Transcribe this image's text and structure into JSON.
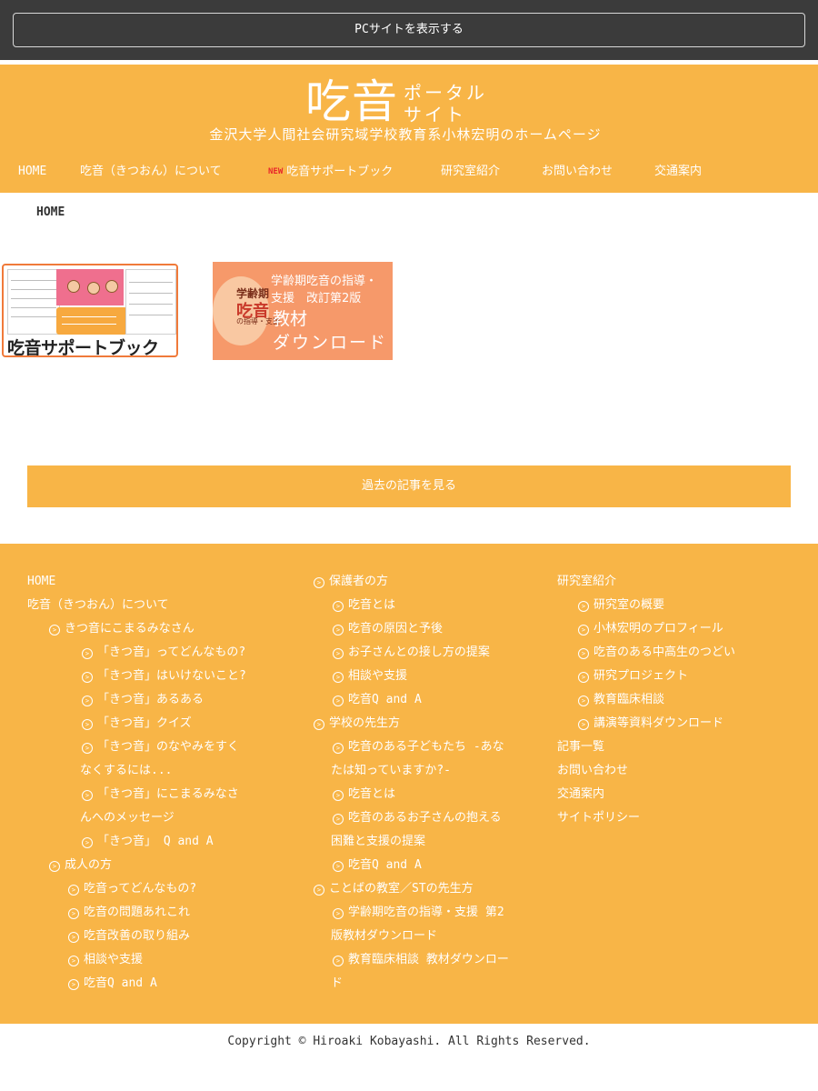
{
  "topbar": {
    "pc_site_button": "PCサイトを表示する"
  },
  "header": {
    "logo_main": "吃音",
    "logo_sub_line1": "ポータル",
    "logo_sub_line2": "サイト",
    "tagline": "金沢大学人間社会研究域学校教育系小林宏明のホームページ"
  },
  "gnav": {
    "items": [
      {
        "label": "HOME"
      },
      {
        "label": "吃音（きつおん）について"
      },
      {
        "label": "吃音サポートブック",
        "badge": "NEW"
      },
      {
        "label": "研究室紹介"
      },
      {
        "label": "お問い合わせ"
      },
      {
        "label": "交通案内"
      }
    ]
  },
  "breadcrumb": "HOME",
  "banners": {
    "support_book": {
      "title": "吃音サポートブック"
    },
    "download": {
      "book_title_small": "学齢期",
      "book_title_big": "吃音",
      "book_subtitle": "の指導・支援",
      "line1": "学齢期吃音の指導・",
      "line2": "支援　改訂第2版",
      "line3": "教材",
      "line4": "ダウンロード"
    }
  },
  "more_button": "過去の記事を見る",
  "footer": {
    "col1": [
      {
        "label": "HOME"
      },
      {
        "label": "吃音（きつおん）について"
      },
      {
        "label": "きつ音にこまるみなさん"
      },
      {
        "label": "「きつ音」ってどんなもの?"
      },
      {
        "label": "「きつ音」はいけないこと?"
      },
      {
        "label": "「きつ音」あるある"
      },
      {
        "label": "「きつ音」クイズ"
      },
      {
        "label": "「きつ音」のなやみをすく"
      },
      {
        "label": "なくするには..."
      },
      {
        "label": "「きつ音」にこまるみなさ"
      },
      {
        "label": "んへのメッセージ"
      },
      {
        "label": "「きつ音」 Q and A"
      },
      {
        "label": "成人の方"
      },
      {
        "label": "吃音ってどんなもの?"
      },
      {
        "label": "吃音の問題あれこれ"
      },
      {
        "label": "吃音改善の取り組み"
      },
      {
        "label": "相談や支援"
      },
      {
        "label": "吃音Q and A"
      }
    ],
    "col2": [
      {
        "label": "保護者の方"
      },
      {
        "label": "吃音とは"
      },
      {
        "label": "吃音の原因と予後"
      },
      {
        "label": "お子さんとの接し方の提案"
      },
      {
        "label": "相談や支援"
      },
      {
        "label": "吃音Q and A"
      },
      {
        "label": "学校の先生方"
      },
      {
        "label": "吃音のある子どもたち -あな"
      },
      {
        "label": "たは知っていますか?-"
      },
      {
        "label": "吃音とは"
      },
      {
        "label": "吃音のあるお子さんの抱える"
      },
      {
        "label": "困難と支援の提案"
      },
      {
        "label": "吃音Q and A"
      },
      {
        "label": "ことばの教室／STの先生方"
      },
      {
        "label": "学齢期吃音の指導・支援 第2"
      },
      {
        "label": "版教材ダウンロード"
      },
      {
        "label": "教育臨床相談 教材ダウンロー"
      },
      {
        "label": "ド"
      }
    ],
    "col3": [
      {
        "label": "研究室紹介"
      },
      {
        "label": "研究室の概要"
      },
      {
        "label": "小林宏明のプロフィール"
      },
      {
        "label": "吃音のある中高生のつどい"
      },
      {
        "label": "研究プロジェクト"
      },
      {
        "label": "教育臨床相談"
      },
      {
        "label": "講演等資料ダウンロード"
      },
      {
        "label": "記事一覧"
      },
      {
        "label": "お問い合わせ"
      },
      {
        "label": "交通案内"
      },
      {
        "label": "サイトポリシー"
      }
    ],
    "copyright": "Copyright © Hiroaki Kobayashi. All Rights Reserved."
  },
  "colors": {
    "accent": "#f8b547",
    "topbar": "#3b3b3b",
    "new_badge": "#e8262a",
    "banner_orange": "#f6996a"
  }
}
